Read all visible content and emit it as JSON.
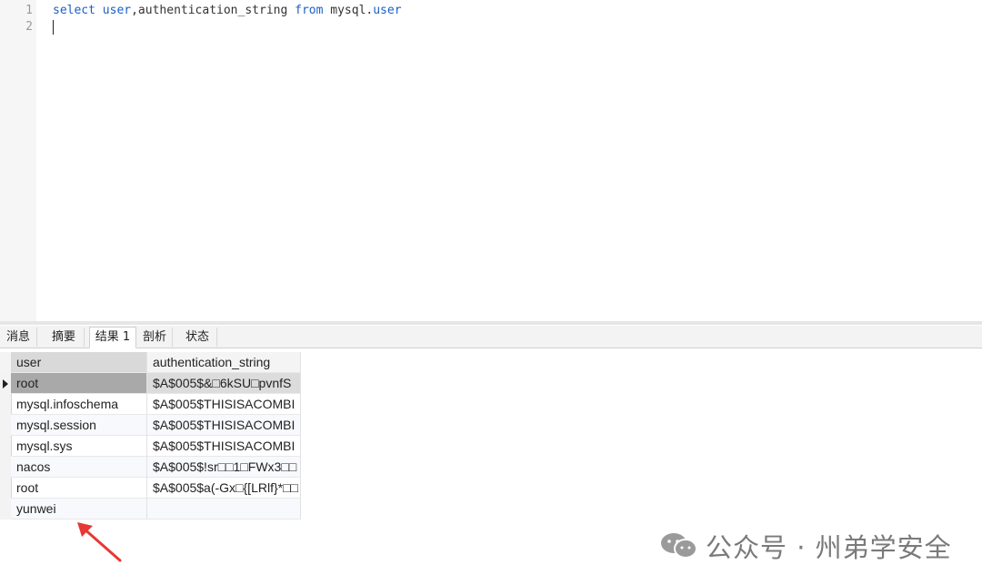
{
  "editor": {
    "line_numbers": [
      "1",
      "2"
    ],
    "line1": {
      "kw_select": "select",
      "kw_user": "user",
      "text_mid": ",authentication_string",
      "kw_from": "from",
      "text_table": "mysql.",
      "kw_user2": "user"
    }
  },
  "tabs": [
    {
      "label": "消息"
    },
    {
      "label": "摘要"
    },
    {
      "label": "结果 1"
    },
    {
      "label": "剖析"
    },
    {
      "label": "状态"
    }
  ],
  "grid": {
    "columns": [
      "user",
      "authentication_string"
    ],
    "rows": [
      {
        "user": "root",
        "auth": "$A$005$&□6kSU□pvnfS",
        "current": true
      },
      {
        "user": "mysql.infoschema",
        "auth": "$A$005$THISISACOMBI"
      },
      {
        "user": "mysql.session",
        "auth": "$A$005$THISISACOMBI"
      },
      {
        "user": "mysql.sys",
        "auth": "$A$005$THISISACOMBI"
      },
      {
        "user": "nacos",
        "auth": "$A$005$!sr□□1□FWx3□□"
      },
      {
        "user": "root",
        "auth": "$A$005$a(-Gx□{[LRlf}*□□"
      },
      {
        "user": "yunwei",
        "auth": ""
      }
    ]
  },
  "watermark": {
    "text": "公众号 · 州弟学安全",
    "icon": "wechat-icon"
  },
  "annotation": {
    "icon": "red-arrow-icon",
    "color": "#e53935"
  },
  "colors": {
    "keyword": "#1a5fc7",
    "selected_row": "#a9a9a9"
  }
}
